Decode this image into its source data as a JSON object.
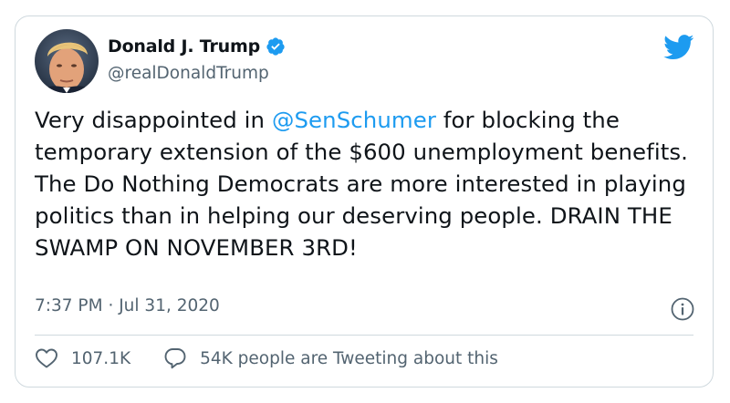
{
  "tweet": {
    "author": {
      "display_name": "Donald J. Trump",
      "handle": "@realDonaldTrump",
      "verified": true
    },
    "text_parts": {
      "before_mention": "Very disappointed in ",
      "mention": "@SenSchumer",
      "after_mention": " for blocking the temporary extension of the $600 unemployment benefits. The Do Nothing Democrats are more interested in playing politics than in helping our deserving people. DRAIN THE SWAMP ON NOVEMBER 3RD!"
    },
    "time": "7:37 PM",
    "separator": "·",
    "date": "Jul 31, 2020",
    "likes": "107.1K",
    "conversation_label": "54K people are Tweeting about this"
  },
  "icons": {
    "brand": "twitter-bird-icon",
    "verified": "verified-badge-icon",
    "info": "info-icon",
    "like": "heart-icon",
    "reply": "speech-bubble-icon"
  },
  "colors": {
    "accent": "#1d9bf0",
    "text": "#0f1419",
    "secondary": "#536471",
    "border": "#cfd9de"
  }
}
